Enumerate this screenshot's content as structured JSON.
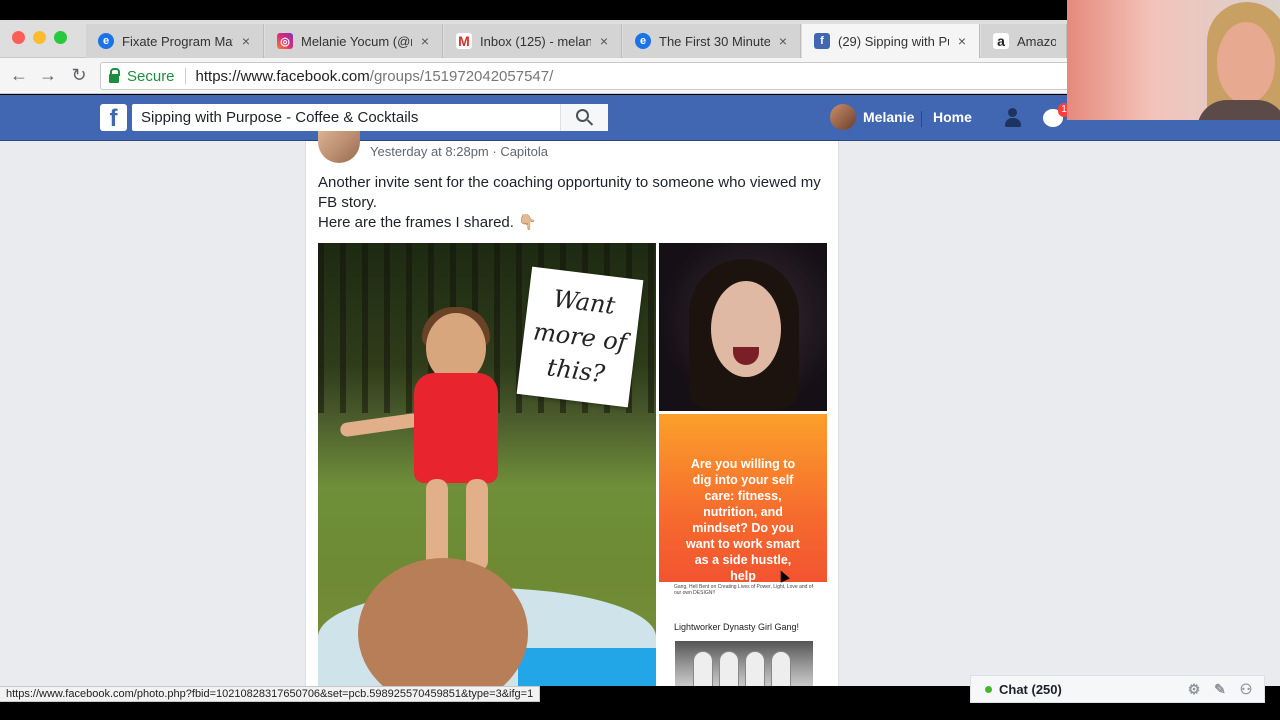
{
  "browser": {
    "tabs": [
      {
        "title": "Fixate Program Mat",
        "favicon": "globe-icon",
        "color": "#1a73e8",
        "active": false
      },
      {
        "title": "Melanie Yocum (@m",
        "favicon": "instagram-icon",
        "color": "#c13584",
        "active": false
      },
      {
        "title": "Inbox (125) - melan",
        "favicon": "gmail-icon",
        "color": "#d93025",
        "active": false
      },
      {
        "title": "The First 30 Minute",
        "favicon": "globe-icon",
        "color": "#1a73e8",
        "active": false
      },
      {
        "title": "(29) Sipping with Pu",
        "favicon": "facebook-icon",
        "color": "#4267b2",
        "active": true
      },
      {
        "title": "Amazon",
        "favicon": "amazon-icon",
        "color": "#222222",
        "active": false
      }
    ],
    "close_glyph": "×",
    "secure_label": "Secure",
    "url_host": "https://www.facebook.com",
    "url_path": "/groups/151972042057547/",
    "status_url": "https://www.facebook.com/photo.php?fbid=10210828317650706&set=pcb.598925570459851&type=3&ifg=1"
  },
  "facebook": {
    "logo": "f",
    "search_value": "Sipping with Purpose - Coffee & Cocktails",
    "user_name": "Melanie",
    "home_label": "Home",
    "messenger_badge": "1",
    "brand_color": "#4267b2"
  },
  "post": {
    "meta": "Yesterday at 8:28pm · Capitola",
    "text_line1": "Another invite sent for the coaching opportunity to someone who viewed my FB story.",
    "text_line2": "Here are the frames I shared.",
    "emoji": "👇🏼",
    "sticker_text": "Want more of this?",
    "orange_text": "Are you willing to dig into your self care: fitness, nutrition, and mindset? Do you want to work smart as a side hustle, help",
    "flyer_small_text": "Gang, Hell Bent on Creating Lives of Power, Light, Love and of our own DESIGN!!",
    "flyer_title": "Lightworker Dynasty Girl Gang!"
  },
  "chat": {
    "label": "Chat (250)"
  }
}
